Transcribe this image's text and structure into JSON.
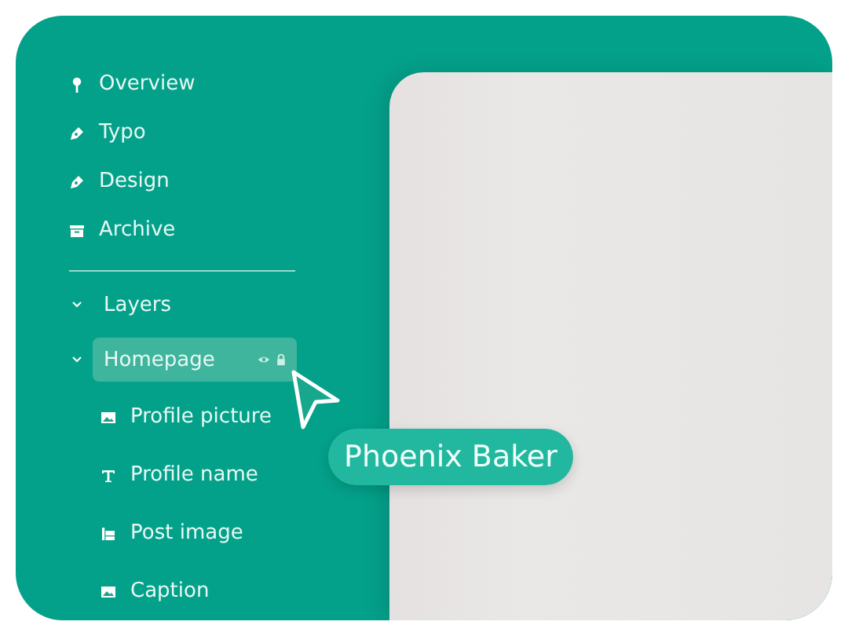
{
  "nav": [
    {
      "label": "Overview"
    },
    {
      "label": "Typo"
    },
    {
      "label": "Design"
    },
    {
      "label": "Archive"
    }
  ],
  "layers": {
    "label": "Layers",
    "expanded": true,
    "children": [
      {
        "label": "Homepage",
        "selected": true,
        "expanded": true,
        "children": [
          {
            "label": "Profile picture",
            "kind": "image"
          },
          {
            "label": "Profile name",
            "kind": "text"
          },
          {
            "label": "Post image",
            "kind": "layout"
          },
          {
            "label": "Caption",
            "kind": "image"
          }
        ]
      }
    ]
  },
  "tooltip": {
    "text": "Phoenix Baker"
  }
}
